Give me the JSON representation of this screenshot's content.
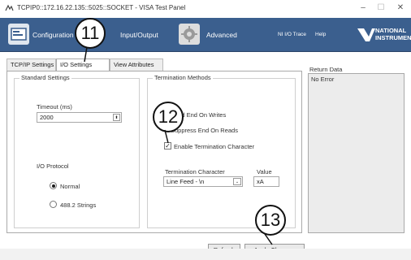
{
  "window": {
    "title": "TCPIP0::172.16.22.135::5025::SOCKET - VISA Test Panel",
    "controls": {
      "minimize": "–",
      "maximize": "☐",
      "close": "✕"
    }
  },
  "toolbar": {
    "configuration": "Configuration",
    "input_output": "Input/Output",
    "advanced": "Advanced",
    "ni_io_trace": "NI I/O Trace",
    "help": "Help",
    "brand_line1": "NATIONAL",
    "brand_line2": "INSTRUMENTS"
  },
  "tabs": [
    "TCP/IP Settings",
    "I/O Settings",
    "View Attributes"
  ],
  "active_tab": "I/O Settings",
  "standard_settings": {
    "title": "Standard Settings",
    "timeout_label": "Timeout (ms)",
    "timeout_value": "2000",
    "io_protocol_label": "I/O Protocol",
    "protocol_options": [
      "Normal",
      "488.2 Strings"
    ],
    "protocol_selected": "Normal"
  },
  "termination": {
    "title": "Termination Methods",
    "send_end_on_writes": "Send End On Writes",
    "suppress_end_on_reads": "Suppress End On Reads",
    "enable_termination_character": "Enable Termination Character",
    "enable_termination_checked": true,
    "term_char_label": "Termination Character",
    "term_char_value": "Line Feed - \\n",
    "value_label": "Value",
    "value_value": "xA"
  },
  "return_data": {
    "label": "Return Data",
    "text": "No Error"
  },
  "buttons": {
    "refresh": "Refresh",
    "apply_changes": "Apply Changes"
  },
  "callouts": [
    "11",
    "12",
    "13"
  ],
  "colors": {
    "toolbar_bg": "#3b5f8e",
    "callout_border": "#111111"
  }
}
